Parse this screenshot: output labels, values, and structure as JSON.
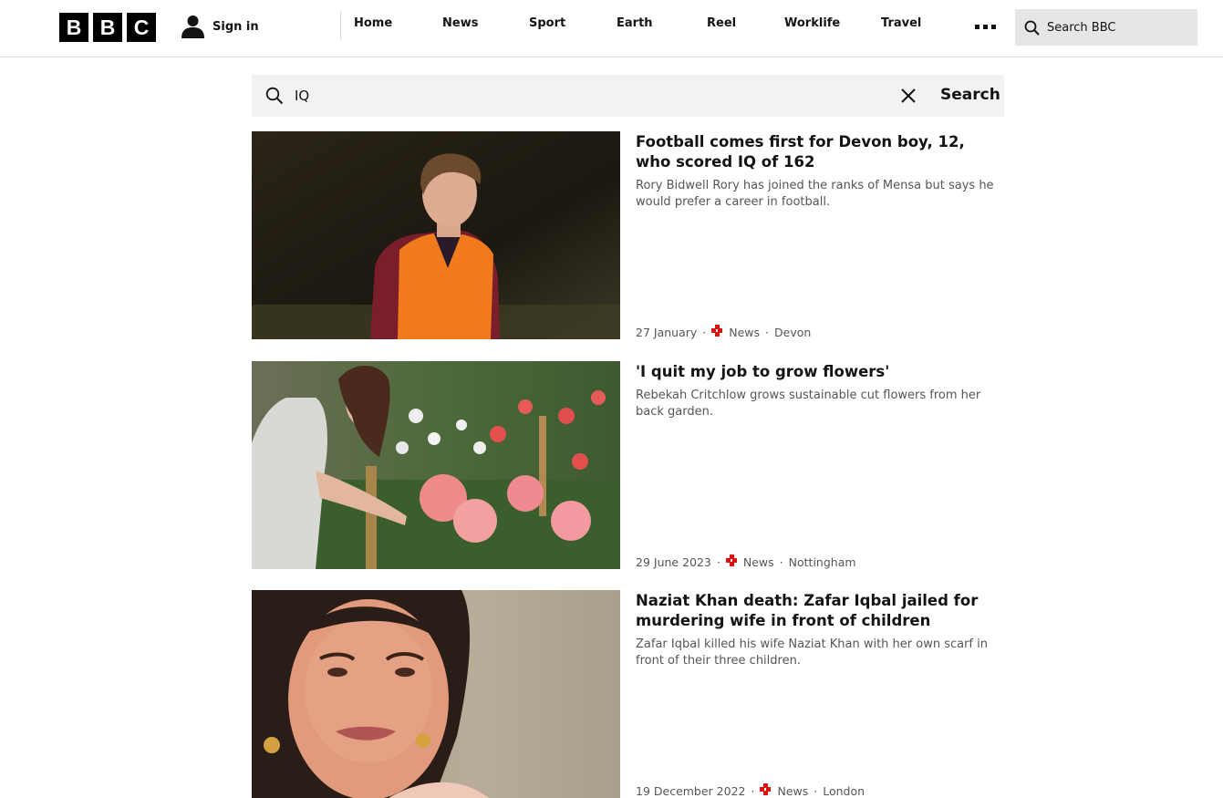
{
  "header": {
    "logo": [
      "B",
      "B",
      "C"
    ],
    "sign_in": "Sign in",
    "nav": [
      "Home",
      "News",
      "Sport",
      "Earth",
      "Reel",
      "Worklife",
      "Travel"
    ],
    "search_placeholder": "Search BBC"
  },
  "search": {
    "query": "IQ",
    "button": "Search"
  },
  "results": [
    {
      "title": "Football comes first for Devon boy, 12, who scored IQ of 162",
      "description": "Rory Bidwell Rory has joined the ranks of Mensa but says he would prefer a career in football.",
      "date": "27 January",
      "section": "News",
      "location": "Devon"
    },
    {
      "title": "'I quit my job to grow flowers'",
      "description": "Rebekah Critchlow grows sustainable cut flowers from her back garden.",
      "date": "29 June 2023",
      "section": "News",
      "location": "Nottingham"
    },
    {
      "title": "Naziat Khan death: Zafar Iqbal jailed for murdering wife in front of children",
      "description": "Zafar Iqbal killed his wife Naziat Khan with her own scarf in front of their three children.",
      "date": "19 December 2022",
      "section": "News",
      "location": "London"
    }
  ],
  "colors": {
    "brand_black": "#000000",
    "news_red": "#e01010",
    "search_bg": "#f2f2f2",
    "header_search_bg": "#e6e6e6"
  },
  "icons": [
    "user-icon",
    "more-icon",
    "search-icon",
    "close-icon",
    "news-icon"
  ]
}
